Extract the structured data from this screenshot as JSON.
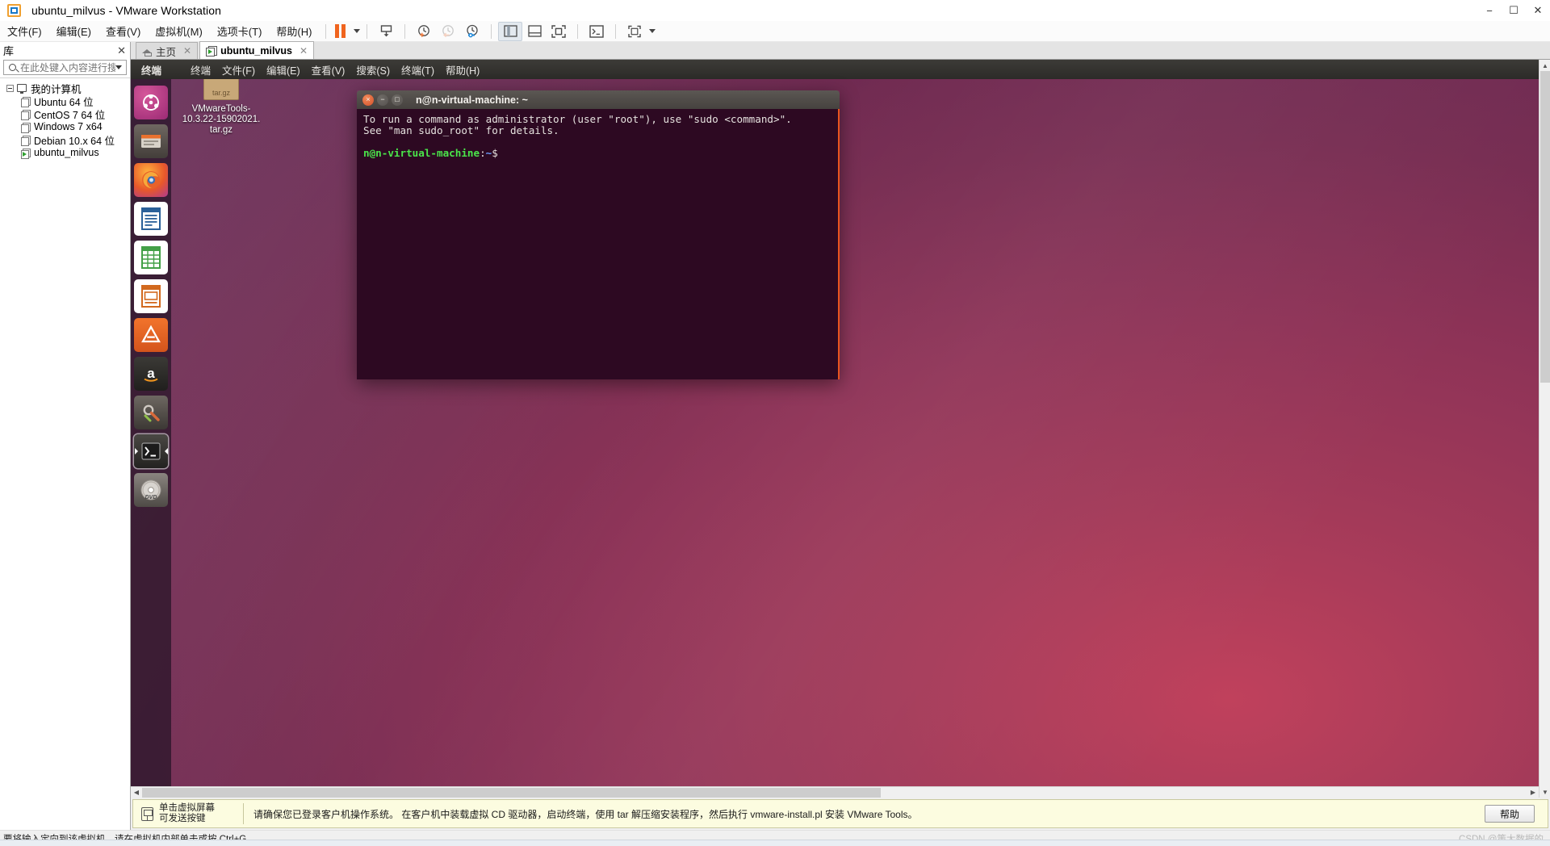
{
  "window": {
    "title": "ubuntu_milvus - VMware Workstation",
    "app_icon": "vmware-logo-icon",
    "controls": {
      "minimize": "−",
      "maximize": "☐",
      "close": "✕"
    }
  },
  "menubar": {
    "items": [
      {
        "label": "文件(F)",
        "name": "menu-file"
      },
      {
        "label": "编辑(E)",
        "name": "menu-edit"
      },
      {
        "label": "查看(V)",
        "name": "menu-view"
      },
      {
        "label": "虚拟机(M)",
        "name": "menu-vm"
      },
      {
        "label": "选项卡(T)",
        "name": "menu-tabs"
      },
      {
        "label": "帮助(H)",
        "name": "menu-help"
      }
    ],
    "toolbar": [
      {
        "name": "pause-button",
        "icon": "pause-icon"
      },
      {
        "name": "power-dropdown",
        "icon": "chevron-down-icon"
      },
      {
        "name": "manage-snapshot-button",
        "icon": "snapshot-manager-icon"
      },
      {
        "name": "take-snapshot-button",
        "icon": "snapshot-add-icon"
      },
      {
        "name": "revert-snapshot-button",
        "icon": "snapshot-revert-icon"
      },
      {
        "name": "snapshot-manager-button",
        "icon": "snapshot-settings-icon"
      },
      {
        "name": "show-library-button",
        "icon": "panel-left-icon"
      },
      {
        "name": "show-thumbnail-bar-button",
        "icon": "panel-bottom-icon"
      },
      {
        "name": "fullscreen-button",
        "icon": "fullscreen-icon"
      },
      {
        "name": "console-button",
        "icon": "terminal-icon"
      },
      {
        "name": "unity-button",
        "icon": "unity-icon"
      },
      {
        "name": "unity-dropdown",
        "icon": "chevron-down-icon"
      }
    ]
  },
  "library": {
    "title": "库",
    "close_label": "✕",
    "search": {
      "placeholder": "在此处键入内容进行搜索",
      "value": "",
      "icon": "search-icon"
    },
    "root": {
      "label": "我的计算机",
      "icon": "computer-icon"
    },
    "items": [
      {
        "label": "Ubuntu 64 位",
        "running": false
      },
      {
        "label": "CentOS 7 64 位",
        "running": false
      },
      {
        "label": "Windows 7 x64",
        "running": false
      },
      {
        "label": "Debian 10.x 64 位",
        "running": false
      },
      {
        "label": "ubuntu_milvus",
        "running": true
      }
    ]
  },
  "tabs": [
    {
      "label": "主页",
      "icon": "home-icon",
      "active": false,
      "close": "✕"
    },
    {
      "label": "ubuntu_milvus",
      "icon": "vm-running-icon",
      "active": true,
      "close": "✕"
    }
  ],
  "guest": {
    "menubar": {
      "app_name": "终端",
      "items": [
        "终端",
        "文件(F)",
        "编辑(E)",
        "查看(V)",
        "搜索(S)",
        "终端(T)",
        "帮助(H)"
      ]
    },
    "launcher": [
      {
        "name": "dash-home",
        "icon": "ubuntu-dash-icon"
      },
      {
        "name": "files",
        "icon": "files-icon"
      },
      {
        "name": "firefox",
        "icon": "firefox-icon"
      },
      {
        "name": "libreoffice-writer",
        "icon": "writer-icon"
      },
      {
        "name": "libreoffice-calc",
        "icon": "calc-icon"
      },
      {
        "name": "libreoffice-impress",
        "icon": "impress-icon"
      },
      {
        "name": "ubuntu-software",
        "icon": "software-center-icon"
      },
      {
        "name": "amazon",
        "icon": "amazon-icon"
      },
      {
        "name": "system-settings",
        "icon": "settings-icon"
      },
      {
        "name": "terminal",
        "icon": "terminal-icon",
        "selected": true
      },
      {
        "name": "disc-drive",
        "icon": "dvd-icon"
      }
    ],
    "desktop_icon": {
      "name": "vmware-tools-archive",
      "icon": "tar-gz-icon",
      "badge": "tar.gz",
      "caption_lines": [
        "VMwareTools-",
        "10.3.22-15902021.",
        "tar.gz"
      ]
    },
    "terminal": {
      "title": "n@n-virtual-machine: ~",
      "buttons": {
        "close": "×",
        "minimize": "−",
        "maximize": "□"
      },
      "lines": [
        "To run a command as administrator (user \"root\"), use \"sudo <command>\".",
        "See \"man sudo_root\" for details."
      ],
      "prompt_user": "n@n-virtual-machine",
      "prompt_sep": ":",
      "prompt_path": "~",
      "prompt_char": "$"
    }
  },
  "hintbar": {
    "key_icon": "keyboard-icon",
    "left_line1": "单击虚拟屏幕",
    "left_line2": "可发送按键",
    "message": "请确保您已登录客户机操作系统。 在客户机中装载虚拟 CD 驱动器，启动终端，使用 tar 解压缩安装程序，然后执行 vmware-install.pl 安装 VMware Tools。",
    "help_label": "帮助"
  },
  "statusbar": {
    "message": "要将输入定向到该虚拟机，请在虚拟机内部单击或按 Ctrl+G。",
    "watermark": "CSDN @策大数据的"
  },
  "scrollbars": {
    "left_arrow": "◀",
    "right_arrow": "▶",
    "up_arrow": "▲",
    "down_arrow": "▼"
  },
  "colors": {
    "ubuntu_orange": "#e95420",
    "terminal_bg": "#2d0922",
    "prompt_green": "#4ae54a",
    "prompt_blue": "#6d9eff",
    "accent_blue": "#1878c8"
  }
}
